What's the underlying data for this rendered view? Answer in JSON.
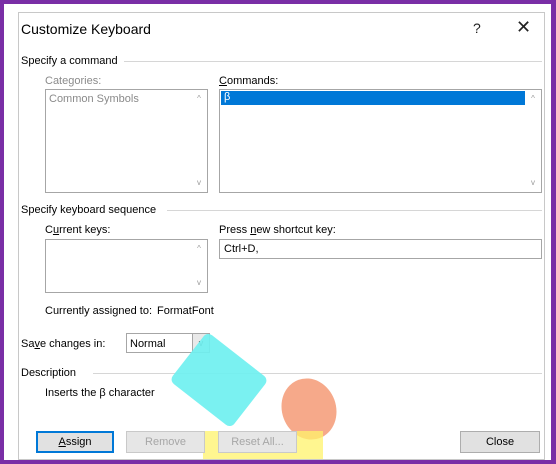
{
  "dialog": {
    "title": "Customize Keyboard",
    "help_glyph": "?",
    "close_glyph": "✕"
  },
  "specify_command": {
    "group_label": "Specify a command",
    "categories_label": "Categories:",
    "categories_items": [
      "Common Symbols"
    ],
    "commands_label_pre": "",
    "commands_label_u": "C",
    "commands_label_post": "ommands:",
    "commands_items": [
      "β"
    ]
  },
  "keyboard_sequence": {
    "group_label": "Specify keyboard sequence",
    "current_keys_label_pre": "C",
    "current_keys_label_u": "u",
    "current_keys_label_post": "rrent keys:",
    "press_label_pre": "Press ",
    "press_label_u": "n",
    "press_label_post": "ew shortcut key:",
    "shortcut_value": "Ctrl+D,",
    "currently_assigned_label": "Currently assigned to:",
    "currently_assigned_value": "FormatFont"
  },
  "save_changes": {
    "label_pre": "Sa",
    "label_u": "v",
    "label_post": "e changes in:",
    "selected": "Normal"
  },
  "description": {
    "group_label": "Description",
    "text": "Inserts the β character"
  },
  "buttons": {
    "assign_u": "A",
    "assign_post": "ssign",
    "remove": "Remove",
    "reset_all": "Reset All...",
    "close": "Close"
  },
  "colors": {
    "frame": "#7a2ea6",
    "selection": "#0078d7",
    "decor_cyan": "#6ff0f0",
    "decor_salmon": "#f6a98a",
    "decor_yellow": "#fff36b"
  }
}
